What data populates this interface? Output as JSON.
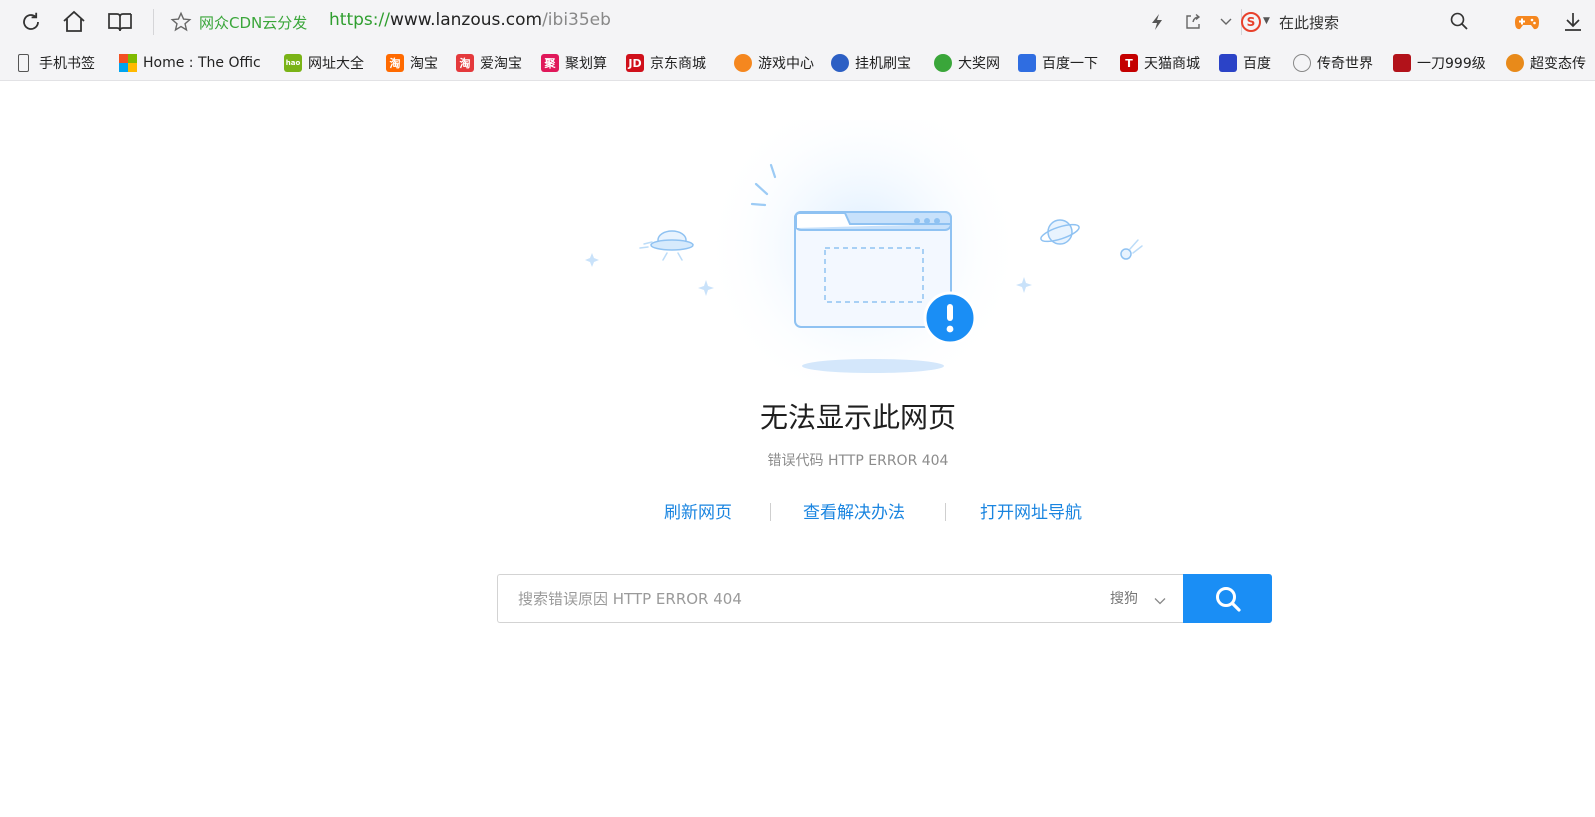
{
  "toolbar": {
    "icons": [
      "refresh-icon",
      "home-icon",
      "reading-icon",
      "star-icon",
      "lightning-icon",
      "share-icon",
      "chevron-down-icon",
      "game-icon",
      "download-icon"
    ],
    "site_tag": "网众CDN云分发",
    "url_scheme": "https://",
    "url_host": "www.lanzous.com",
    "url_path": "/ibi35eb",
    "search_placeholder": "在此搜索",
    "search_logo": "S",
    "accent": "#e8412c"
  },
  "bookmarks": [
    {
      "label": "手机书签",
      "icon": "phone-icon",
      "color": "#555555",
      "glyph": ""
    },
    {
      "label": "Home : The Offic",
      "icon": "microsoft-icon",
      "color": "#f25022",
      "glyph": ""
    },
    {
      "label": "网址大全",
      "icon": "hao-icon",
      "color": "#7ab317",
      "glyph": "hao"
    },
    {
      "label": "淘宝",
      "icon": "taobao-icon",
      "color": "#ff6a00",
      "glyph": "淘"
    },
    {
      "label": "爱淘宝",
      "icon": "aitaobao-icon",
      "color": "#e4393c",
      "glyph": "淘"
    },
    {
      "label": "聚划算",
      "icon": "juhuasuan-icon",
      "color": "#e0185a",
      "glyph": "聚"
    },
    {
      "label": "京东商城",
      "icon": "jd-icon",
      "color": "#d0101b",
      "glyph": "JD"
    },
    {
      "label": "游戏中心",
      "icon": "gamepad-icon",
      "color": "#f5871f",
      "glyph": ""
    },
    {
      "label": "挂机刷宝",
      "icon": "guaji-icon",
      "color": "#2c5fc4",
      "glyph": ""
    },
    {
      "label": "大奖网",
      "icon": "dajiang-icon",
      "color": "#3aa63a",
      "glyph": ""
    },
    {
      "label": "百度一下",
      "icon": "baidu-paw-icon",
      "color": "#2f6de1",
      "glyph": ""
    },
    {
      "label": "天猫商城",
      "icon": "tmall-icon",
      "color": "#c40000",
      "glyph": "T"
    },
    {
      "label": "百度",
      "icon": "baidu-icon",
      "color": "#2b43c7",
      "glyph": ""
    },
    {
      "label": "传奇世界",
      "icon": "globe-icon",
      "color": "#888888",
      "glyph": ""
    },
    {
      "label": "一刀999级",
      "icon": "yidao-icon",
      "color": "#b2121a",
      "glyph": ""
    },
    {
      "label": "超变态传",
      "icon": "chaobian-icon",
      "color": "#e88a1a",
      "glyph": ""
    }
  ],
  "error": {
    "title": "无法显示此网页",
    "code": "错误代码 HTTP ERROR 404",
    "accent": "#1a8ef5"
  },
  "actions": {
    "refresh": "刷新网页",
    "solutions": "查看解决办法",
    "nav": "打开网址导航"
  },
  "search": {
    "placeholder": "搜索错误原因 HTTP ERROR 404",
    "engine": "搜狗",
    "button_color": "#1a8ef5"
  }
}
